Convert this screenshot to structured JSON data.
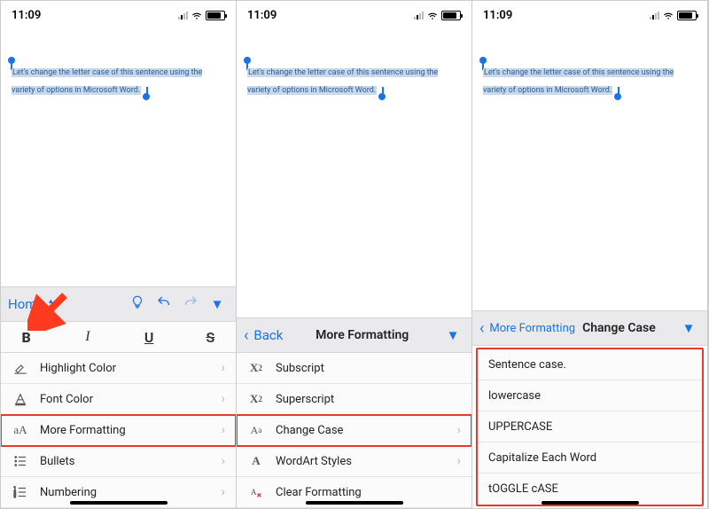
{
  "status": {
    "time": "11:09"
  },
  "document": {
    "selectedText": "Let's change the letter case of this sentence using the variety of options in Microsoft Word."
  },
  "panel1": {
    "toolbar": {
      "home": "Home"
    },
    "rows": {
      "highlight": "Highlight Color",
      "fontColor": "Font Color",
      "moreFormatting": "More Formatting",
      "bullets": "Bullets",
      "numbering": "Numbering"
    }
  },
  "panel2": {
    "toolbar": {
      "back": "Back",
      "title": "More Formatting"
    },
    "rows": {
      "subscript": "Subscript",
      "superscript": "Superscript",
      "changeCase": "Change Case",
      "wordart": "WordArt Styles",
      "clear": "Clear Formatting"
    }
  },
  "panel3": {
    "toolbar": {
      "back": "More Formatting",
      "title": "Change Case"
    },
    "rows": {
      "sentence": "Sentence case.",
      "lower": "lowercase",
      "upper": "UPPERCASE",
      "capEach": "Capitalize Each Word",
      "toggle": "tOGGLE cASE"
    }
  }
}
